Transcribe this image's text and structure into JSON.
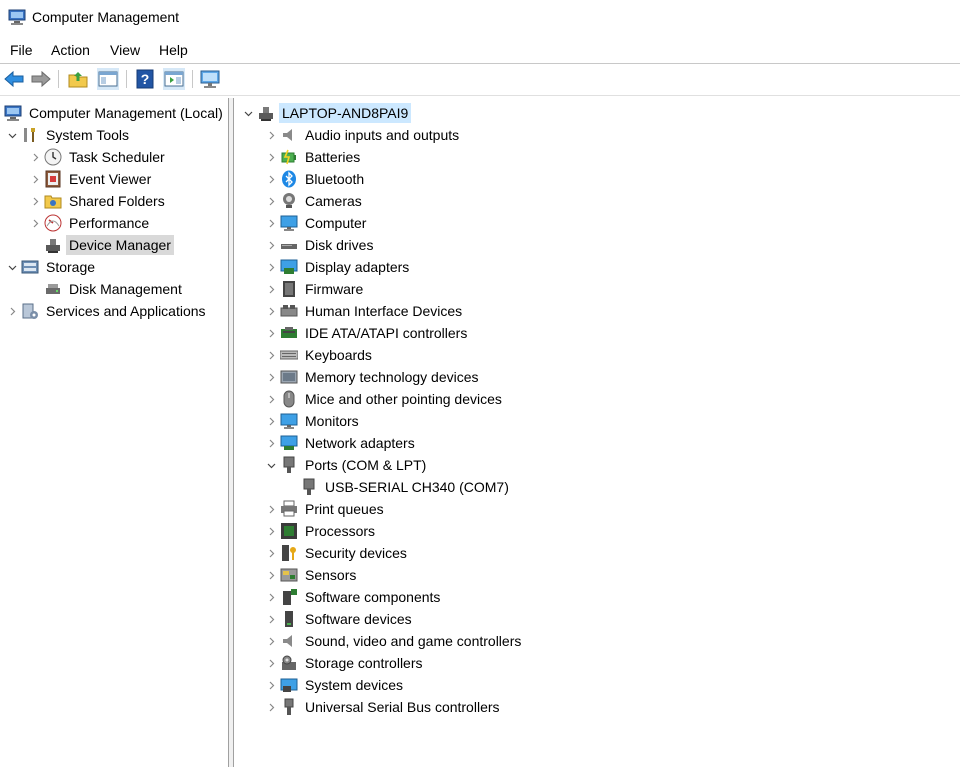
{
  "window": {
    "title": "Computer Management"
  },
  "menu": [
    "File",
    "Action",
    "View",
    "Help"
  ],
  "toolbar": {
    "buttons": [
      "back-arrow-icon",
      "forward-arrow-icon",
      "up-folder-icon",
      "show-hide-tree-icon",
      "help-icon",
      "action-pane-icon",
      "monitor-icon"
    ]
  },
  "left_tree": {
    "root": "Computer Management (Local)",
    "system_tools": "System Tools",
    "task_scheduler": "Task Scheduler",
    "event_viewer": "Event Viewer",
    "shared_folders": "Shared Folders",
    "performance": "Performance",
    "device_manager": "Device Manager",
    "storage": "Storage",
    "disk_management": "Disk Management",
    "services_apps": "Services and Applications"
  },
  "device_tree": {
    "computer_name": "LAPTOP-AND8PAI9",
    "categories": [
      "Audio inputs and outputs",
      "Batteries",
      "Bluetooth",
      "Cameras",
      "Computer",
      "Disk drives",
      "Display adapters",
      "Firmware",
      "Human Interface Devices",
      "IDE ATA/ATAPI controllers",
      "Keyboards",
      "Memory technology devices",
      "Mice and other pointing devices",
      "Monitors",
      "Network adapters",
      "Ports (COM & LPT)",
      "USB-SERIAL CH340 (COM7)",
      "Print queues",
      "Processors",
      "Security devices",
      "Sensors",
      "Software components",
      "Software devices",
      "Sound, video and game controllers",
      "Storage controllers",
      "System devices",
      "Universal Serial Bus controllers"
    ]
  },
  "colors": {
    "selection_gray": "#d9d9d9",
    "selection_blue": "#cce8ff",
    "accent_blue": "#1e88e5"
  }
}
